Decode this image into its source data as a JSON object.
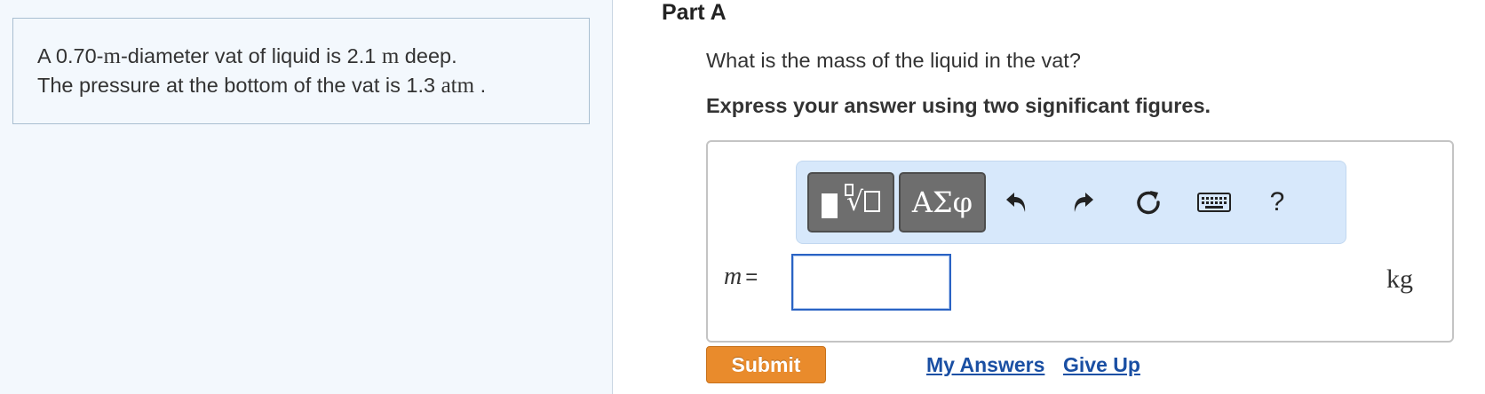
{
  "problem": {
    "line1_pre": "A 0.70-",
    "line1_unit": "m",
    "line1_mid": "-diameter vat of liquid is 2.1 ",
    "line1_unit2": "m",
    "line1_post": " deep.",
    "line2_pre": "The pressure at the bottom of the vat is 1.3 ",
    "line2_unit": "atm",
    "line2_post": " ."
  },
  "part": {
    "title": "Part A",
    "question": "What is the mass of the liquid in the vat?",
    "instruction": "Express your answer using two significant figures."
  },
  "toolbar": {
    "symbols_label": "ΑΣφ",
    "help_label": "?",
    "icons": [
      "templates-icon",
      "undo-icon",
      "redo-icon",
      "reset-icon",
      "keyboard-icon",
      "help-icon"
    ]
  },
  "answer": {
    "variable": "m",
    "equals": "=",
    "value": "",
    "unit": "kg"
  },
  "actions": {
    "submit_label": "Submit",
    "my_answers_label": "My Answers",
    "give_up_label": "Give Up"
  },
  "colors": {
    "submit": "#e98b2c",
    "link": "#1a4fa3",
    "toolbar_bg": "#d7e8fb",
    "input_border": "#2a63c4"
  }
}
